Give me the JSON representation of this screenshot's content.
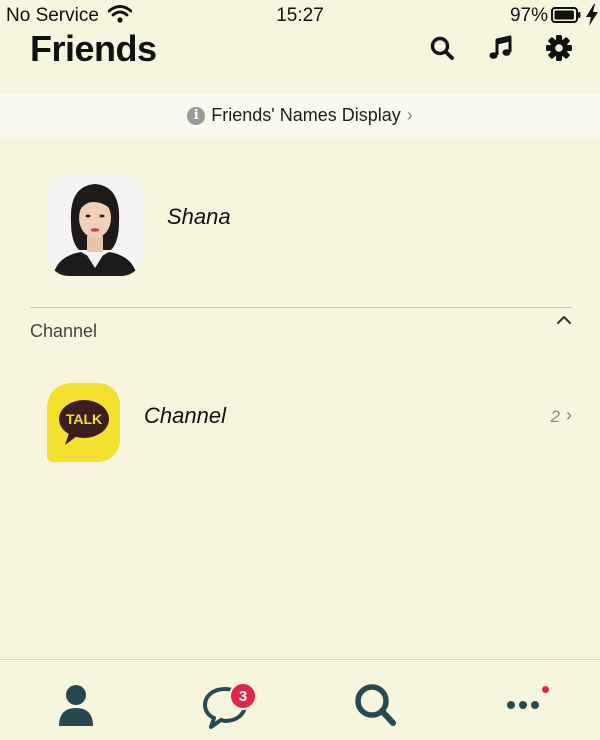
{
  "status_bar": {
    "carrier": "No Service",
    "time": "15:27",
    "battery_percent": "97%",
    "battery_level": 0.97
  },
  "header": {
    "title": "Friends",
    "icons": [
      "search-icon",
      "music-note-icon",
      "gear-icon"
    ]
  },
  "banner": {
    "info_glyph": "i",
    "text": "Friends' Names Display",
    "chevron": "›"
  },
  "profile": {
    "name": "Shana"
  },
  "section": {
    "label": "Channel",
    "collapse_glyph": "^"
  },
  "channel": {
    "logo_text": "TALK",
    "name": "Channel",
    "count": "2",
    "chevron": "›"
  },
  "bottom_nav": {
    "items": [
      "person-icon",
      "chat-bubble-icon",
      "search-icon",
      "more-dots-icon"
    ],
    "chat_badge": "3"
  },
  "colors": {
    "background": "#f6f5dd",
    "banner_background": "#fbfaee",
    "nav_icon": "#264a4f",
    "badge": "#e0264a",
    "talk_yellow": "#f3e02f",
    "talk_brown": "#3c1e1e"
  }
}
